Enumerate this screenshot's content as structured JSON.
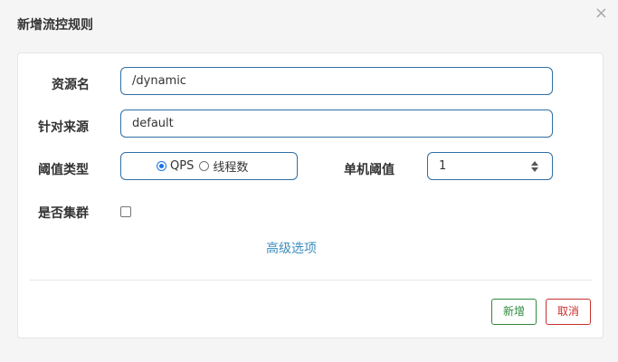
{
  "dialog": {
    "title": "新增流控规则",
    "close_glyph": "×"
  },
  "form": {
    "resource": {
      "label": "资源名",
      "value": "/dynamic"
    },
    "limit_app": {
      "label": "针对来源",
      "value": "default"
    },
    "grade": {
      "label": "阈值类型",
      "options": [
        {
          "label": "QPS",
          "checked": true
        },
        {
          "label": "线程数",
          "checked": false
        }
      ]
    },
    "count": {
      "label": "单机阈值",
      "value": "1"
    },
    "cluster": {
      "label": "是否集群",
      "checked": false
    },
    "advanced_link": "高级选项"
  },
  "footer": {
    "add_label": "新增",
    "cancel_label": "取消"
  },
  "colors": {
    "input_border": "#2f6ea5",
    "link": "#3c8dbc",
    "add_button": "#2e8b3d",
    "cancel_button": "#c9302c"
  }
}
